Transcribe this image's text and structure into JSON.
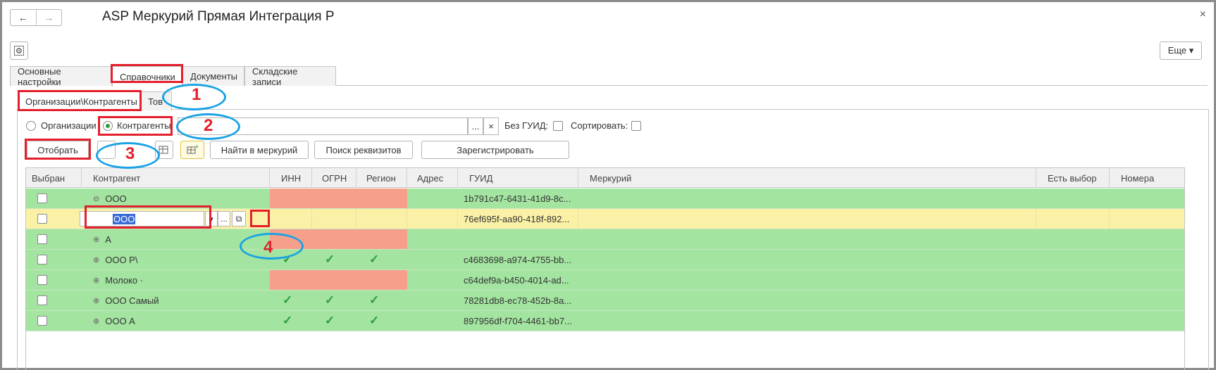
{
  "window": {
    "title": "ASP Меркурий Прямая Интеграция Р",
    "back_icon": "←",
    "forward_icon": "→",
    "close_icon": "×",
    "more_label": "Еще ▾"
  },
  "tabs": [
    "Основные настройки",
    "Справочники",
    "Документы",
    "Складские записи"
  ],
  "subtabs": [
    "Организации\\Контрагенты",
    "Тов"
  ],
  "filter": {
    "radio_org": "Организации",
    "radio_contr": "Контрагенты",
    "select_btn": "...",
    "clear_btn": "×",
    "no_guid": "Без ГУИД:",
    "sort": "Сортировать:"
  },
  "toolbar": {
    "select": "Отобрать",
    "find_mercury": "Найти в меркурий",
    "find_requisites": "Поиск реквизитов",
    "register": "Зарегистрировать"
  },
  "callouts": [
    "1",
    "2",
    "3",
    "4"
  ],
  "columns": [
    "Выбран",
    "Контрагент",
    "ИНН",
    "ОГРН",
    "Регион",
    "Адрес",
    "ГУИД",
    "Меркурий",
    "Есть выбор",
    "Номера"
  ],
  "rows": [
    {
      "tree": "⊖",
      "name": "ООО",
      "guid": "1b791c47-6431-41d9-8c...",
      "inn": "",
      "ogrn": "",
      "region": ""
    },
    {
      "tree": "",
      "name": "ООО",
      "guid": "76ef695f-aa90-418f-892...",
      "inn": "",
      "ogrn": "",
      "region": ""
    },
    {
      "tree": "⊕",
      "name": "А",
      "guid": "",
      "inn": "",
      "ogrn": "",
      "region": ""
    },
    {
      "tree": "⊕",
      "name": "ООО Р\\",
      "guid": "c4683698-a974-4755-bb...",
      "inn": "✓",
      "ogrn": "✓",
      "region": "✓"
    },
    {
      "tree": "⊕",
      "name": "Молоко ·",
      "guid": "c64def9a-b450-4014-ad...",
      "inn": "",
      "ogrn": "",
      "region": ""
    },
    {
      "tree": "⊕",
      "name": "ООО  Самый",
      "guid": "78281db8-ec78-452b-8a...",
      "inn": "✓",
      "ogrn": "✓",
      "region": "✓"
    },
    {
      "tree": "⊕",
      "name": "ООО А",
      "guid": "897956df-f704-4461-bb7...",
      "inn": "✓",
      "ogrn": "✓",
      "region": "✓"
    }
  ],
  "edit": {
    "dropdown_icon": "▾",
    "select_btn": "...",
    "open_icon": "⧉"
  },
  "colors": {
    "green": "#a3e4a0",
    "yellow": "#fbf1a6",
    "salmon": "#f6a08c",
    "red_box": "#e3202b",
    "blue_ellipse": "#1aa3e4"
  }
}
